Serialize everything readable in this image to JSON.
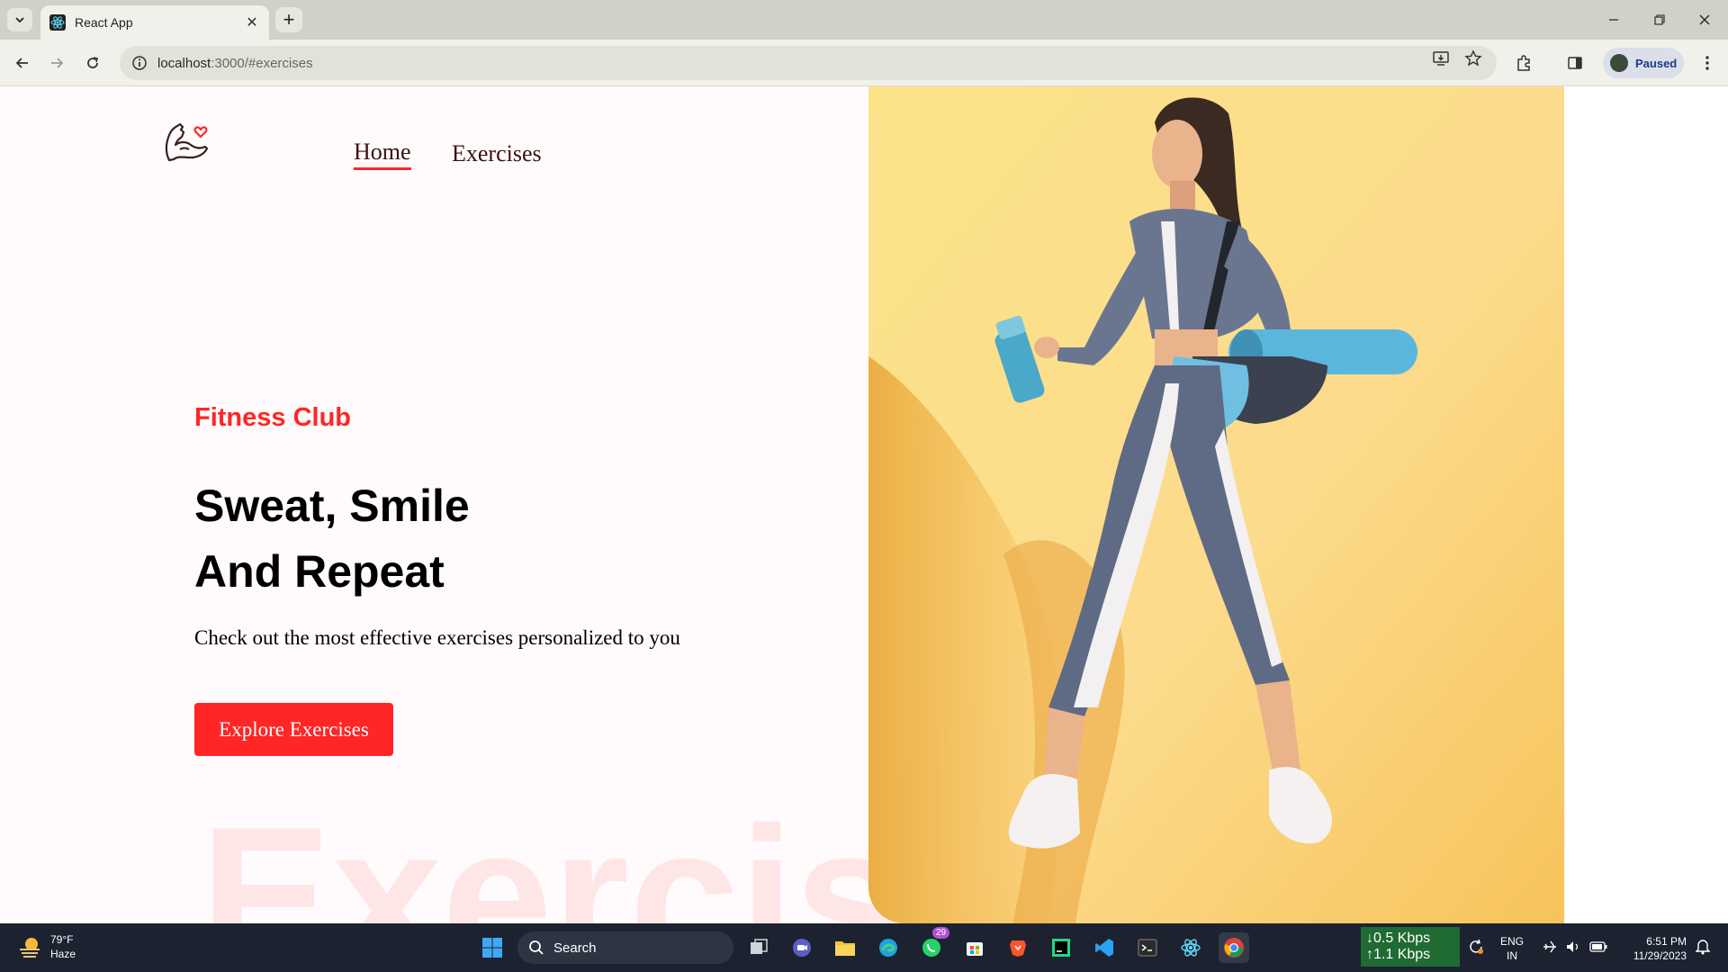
{
  "browser": {
    "tab_title": "React App",
    "url_host": "localhost",
    "url_rest": ":3000/#exercises",
    "profile_label": "Paused"
  },
  "page": {
    "nav": {
      "home": "Home",
      "exercises": "Exercises"
    },
    "hero": {
      "kicker": "Fitness Club",
      "title_line1": "Sweat, Smile",
      "title_line2": "And Repeat",
      "description": "Check out the most effective exercises personalized to you",
      "cta": "Explore Exercises",
      "watermark": "Exercis"
    },
    "colors": {
      "accent": "#ff2625",
      "hero_bg": "#fde1a0"
    }
  },
  "taskbar": {
    "weather_temp": "79°F",
    "weather_desc": "Haze",
    "search_label": "Search",
    "whatsapp_badge": "29",
    "net_down": "↓0.5 Kbps",
    "net_up": "↑1.1 Kbps",
    "lang_line1": "ENG",
    "lang_line2": "IN",
    "time": "6:51 PM",
    "date": "11/29/2023"
  }
}
